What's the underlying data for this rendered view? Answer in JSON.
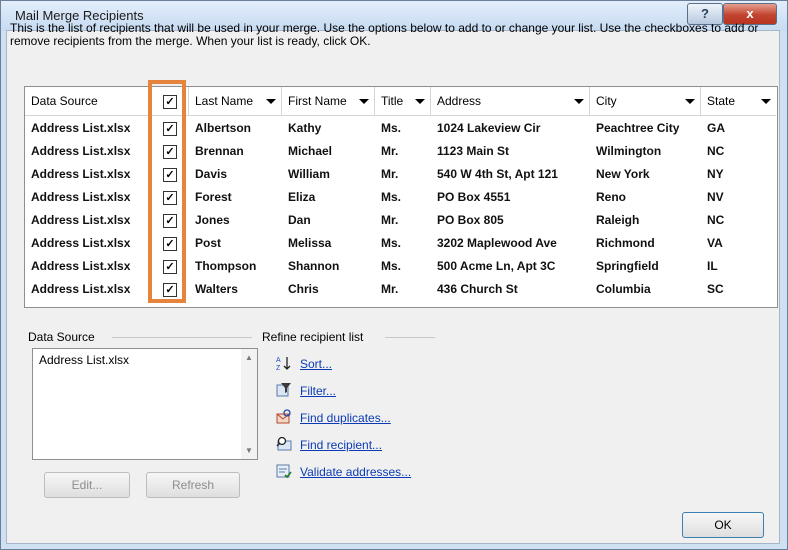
{
  "window": {
    "title": "Mail Merge Recipients",
    "help_glyph": "?",
    "close_glyph": "x"
  },
  "intro_text": "This is the list of recipients that will be used in your merge.  Use the options below to add to or change your list.  Use the checkboxes to add or remove recipients from the merge.  When your list is ready, click OK.",
  "columns": [
    "Data Source",
    "",
    "Last Name",
    "First Name",
    "Title",
    "Address",
    "City",
    "State"
  ],
  "rows": [
    {
      "source": "Address List.xlsx",
      "checked": true,
      "last": "Albertson",
      "first": "Kathy",
      "title": "Ms.",
      "address": "1024 Lakeview Cir",
      "city": "Peachtree City",
      "state": "GA"
    },
    {
      "source": "Address List.xlsx",
      "checked": true,
      "last": "Brennan",
      "first": "Michael",
      "title": "Mr.",
      "address": "1123 Main St",
      "city": "Wilmington",
      "state": "NC"
    },
    {
      "source": "Address List.xlsx",
      "checked": true,
      "last": "Davis",
      "first": "William",
      "title": "Mr.",
      "address": "540 W 4th St, Apt 121",
      "city": "New York",
      "state": "NY"
    },
    {
      "source": "Address List.xlsx",
      "checked": true,
      "last": "Forest",
      "first": "Eliza",
      "title": "Ms.",
      "address": "PO Box 4551",
      "city": "Reno",
      "state": "NV"
    },
    {
      "source": "Address List.xlsx",
      "checked": true,
      "last": "Jones",
      "first": "Dan",
      "title": "Mr.",
      "address": "PO Box 805",
      "city": "Raleigh",
      "state": "NC"
    },
    {
      "source": "Address List.xlsx",
      "checked": true,
      "last": "Post",
      "first": "Melissa",
      "title": "Ms.",
      "address": "3202 Maplewood Ave",
      "city": "Richmond",
      "state": "VA"
    },
    {
      "source": "Address List.xlsx",
      "checked": true,
      "last": "Thompson",
      "first": "Shannon",
      "title": "Ms.",
      "address": "500 Acme Ln, Apt 3C",
      "city": "Springfield",
      "state": "IL"
    },
    {
      "source": "Address List.xlsx",
      "checked": true,
      "last": "Walters",
      "first": "Chris",
      "title": "Mr.",
      "address": "436 Church St",
      "city": "Columbia",
      "state": "SC"
    }
  ],
  "data_source_section": {
    "label": "Data Source",
    "items": [
      "Address List.xlsx"
    ],
    "edit_label": "Edit...",
    "refresh_label": "Refresh"
  },
  "refine": {
    "label": "Refine recipient list",
    "links": [
      {
        "label": "Sort...",
        "icon": "sort-icon"
      },
      {
        "label": "Filter...",
        "icon": "filter-icon"
      },
      {
        "label": "Find duplicates...",
        "icon": "find-duplicates-icon"
      },
      {
        "label": "Find recipient...",
        "icon": "find-recipient-icon"
      },
      {
        "label": "Validate addresses...",
        "icon": "validate-addresses-icon"
      }
    ]
  },
  "ok_label": "OK",
  "colors": {
    "highlight": "#e6843d",
    "link": "#0b3bb4"
  }
}
